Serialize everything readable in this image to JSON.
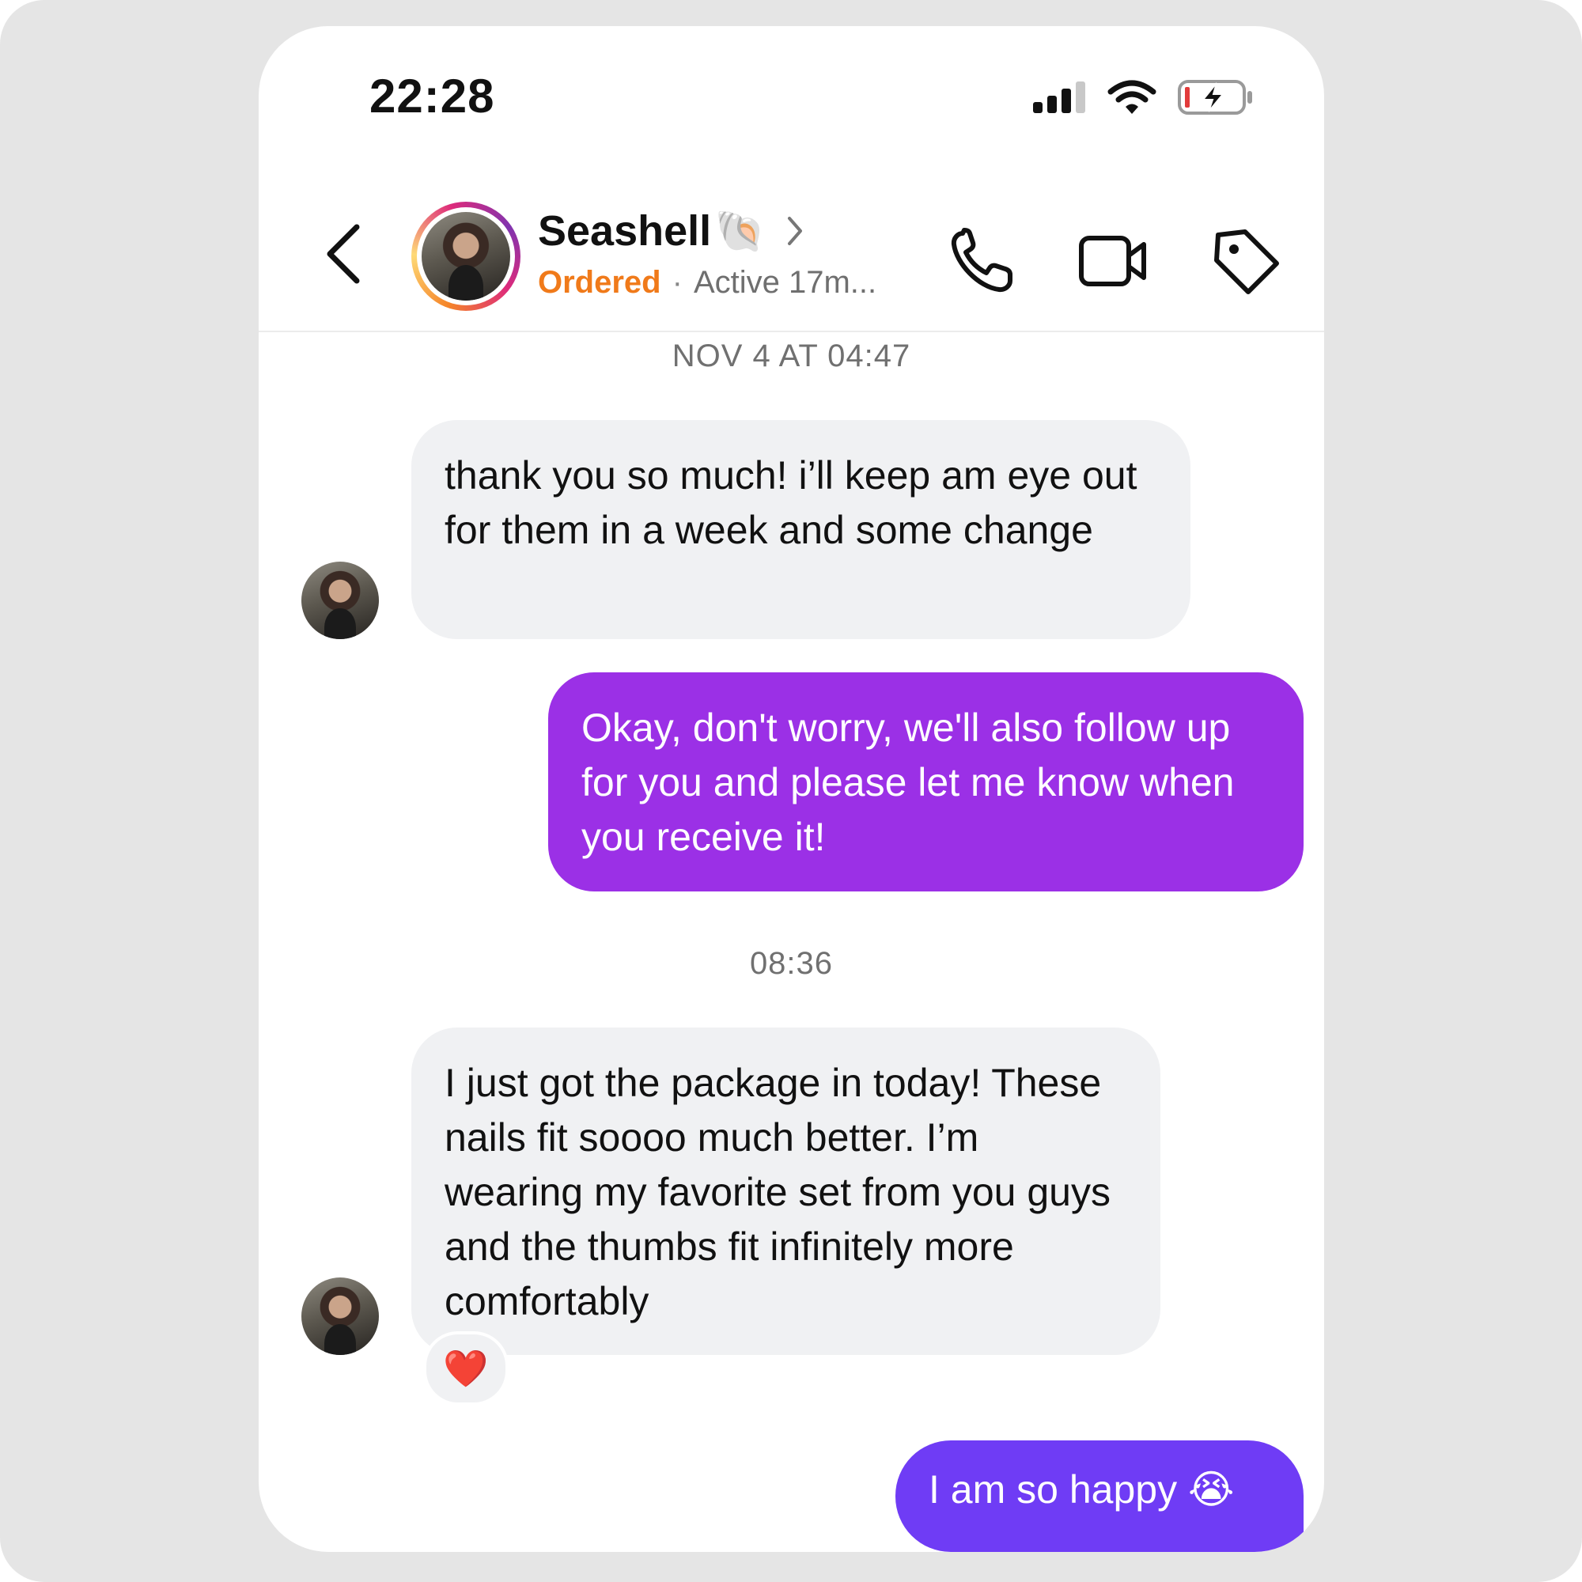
{
  "status_bar": {
    "time": "22:28"
  },
  "header": {
    "contact_name": "Seashell",
    "name_emoji": "🐚",
    "order_status": "Ordered",
    "separator": "·",
    "active_status": "Active 17m...",
    "icons": [
      "back-icon",
      "phone-icon",
      "video-camera-icon",
      "tag-icon"
    ],
    "story_ring_colors": [
      "#f58529",
      "#feda77",
      "#dd2a7b",
      "#8134af"
    ],
    "order_status_color": "#f07a1a"
  },
  "messages": [
    {
      "type": "timestamp",
      "text": "NOV 4 AT 04:47"
    },
    {
      "type": "incoming",
      "text": "thank you so much! i’ll keep am eye out for them in a week and some change"
    },
    {
      "type": "outgoing",
      "text": "Okay, don't worry, we'll also follow up for you and please let me know when you receive it!",
      "color": "#9b30e6"
    },
    {
      "type": "timestamp",
      "text": "08:36"
    },
    {
      "type": "incoming",
      "text": "I just got the package in today! These nails fit soooo much better. I’m wearing my favorite set from you guys and the thumbs fit infinitely more comfortably",
      "reaction": "❤️"
    },
    {
      "type": "outgoing",
      "text": "I am so happy 😭",
      "color": "#6f3cf5"
    }
  ],
  "colors": {
    "incoming_bubble": "#f0f1f3",
    "background_frame": "#e5e5e5"
  }
}
